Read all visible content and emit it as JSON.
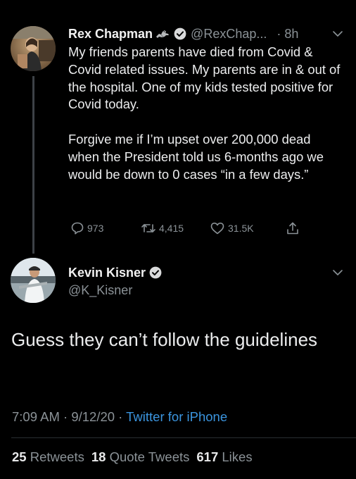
{
  "colors": {
    "background": "#000000",
    "text": "#ecedee",
    "muted": "#8b9297",
    "link": "#3b95df",
    "thread_line": "#3d4247"
  },
  "reply_tweet": {
    "name": "Rex Chapman",
    "handle": "@RexChap...",
    "time": "· 8h",
    "paragraphs": [
      "My friends parents have died from Covid & Covid related issues. My parents are in & out of the hospital. One of my kids tested positive for Covid today.",
      "Forgive me if I’m upset over 200,000 dead when the President told us 6-months ago we would be down to 0 cases “in a few days.”"
    ],
    "actions": {
      "replies": "973",
      "retweets": "4,415",
      "likes": "31.5K"
    },
    "icons": [
      "horse-emoji-icon",
      "verified-badge-icon",
      "chevron-down-icon",
      "reply-icon",
      "retweet-icon",
      "like-icon",
      "share-icon"
    ]
  },
  "main_tweet": {
    "name": "Kevin Kisner",
    "handle": "@K_Kisner",
    "text": "Guess they can’t follow the guidelines",
    "time": "7:09 AM · 9/12/20 ·",
    "source": "Twitter for iPhone",
    "stats": {
      "retweets_count": "25",
      "retweets_label": "Retweets",
      "quotes_count": "18",
      "quotes_label": "Quote Tweets",
      "likes_count": "617",
      "likes_label": "Likes"
    }
  }
}
